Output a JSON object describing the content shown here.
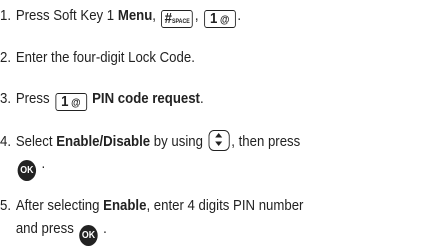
{
  "steps": [
    {
      "num": "1.",
      "text_a": "Press Soft Key 1 ",
      "bold_a": "Menu",
      "text_b": ",",
      "text_c": ",",
      "text_d": "."
    },
    {
      "num": "2.",
      "text": "Enter the four-digit Lock Code."
    },
    {
      "num": "3.",
      "text_a": "Press",
      "bold_a": "PIN code request",
      "text_b": "."
    },
    {
      "num": "4.",
      "text_a": "Select ",
      "bold_a": "Enable/Disable",
      "text_b": " by using",
      "text_c": ", then press",
      "text_d": "."
    },
    {
      "num": "5.",
      "text_a": "After selecting ",
      "bold_a": "Enable",
      "text_b": ", enter 4 digits PIN number",
      "text_c": "and press",
      "text_d": "."
    }
  ],
  "keys": {
    "hash_main": "#",
    "hash_sup": "⚑",
    "hash_sub": "SPACE",
    "one_main": "1",
    "one_sym": "@",
    "ok_label": "OK"
  },
  "icons": {
    "hash": "hash-space-key-icon",
    "one": "one-key-icon",
    "nav": "navigation-key-icon",
    "ok": "ok-key-icon"
  }
}
